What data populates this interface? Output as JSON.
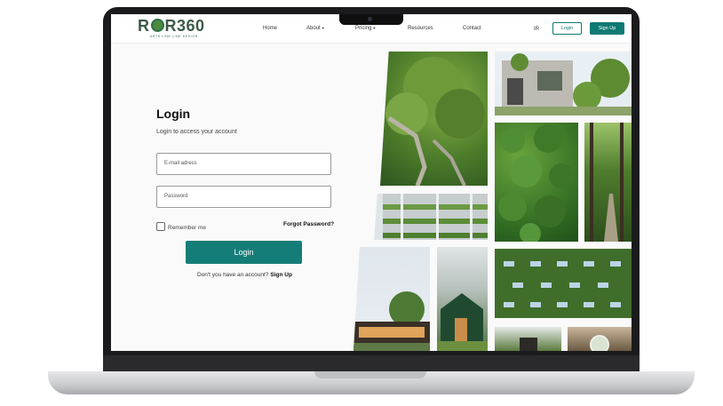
{
  "brand": {
    "logo_text_1": "R",
    "logo_text_2": "R360",
    "tagline": "ARTS LINE LINE DESIGN"
  },
  "nav": {
    "links": [
      {
        "label": "Home"
      },
      {
        "label": "About"
      },
      {
        "label": "Pricing"
      },
      {
        "label": "Resources"
      },
      {
        "label": "Contact"
      }
    ],
    "lang": "IR",
    "login_label": "Login",
    "signup_label": "Sign Up"
  },
  "login": {
    "title": "Login",
    "subtitle": "Login to access your account",
    "email_placeholder": "E-mail adress",
    "password_placeholder": "Password",
    "remember_label": "Remember me",
    "forgot_label": "Forgot Password?",
    "button_label": "Login",
    "no_account_text": "Don't you have an account?",
    "signup_link": "Sign Up"
  },
  "colors": {
    "accent": "#157d77",
    "brand_green": "#3c5a48"
  }
}
